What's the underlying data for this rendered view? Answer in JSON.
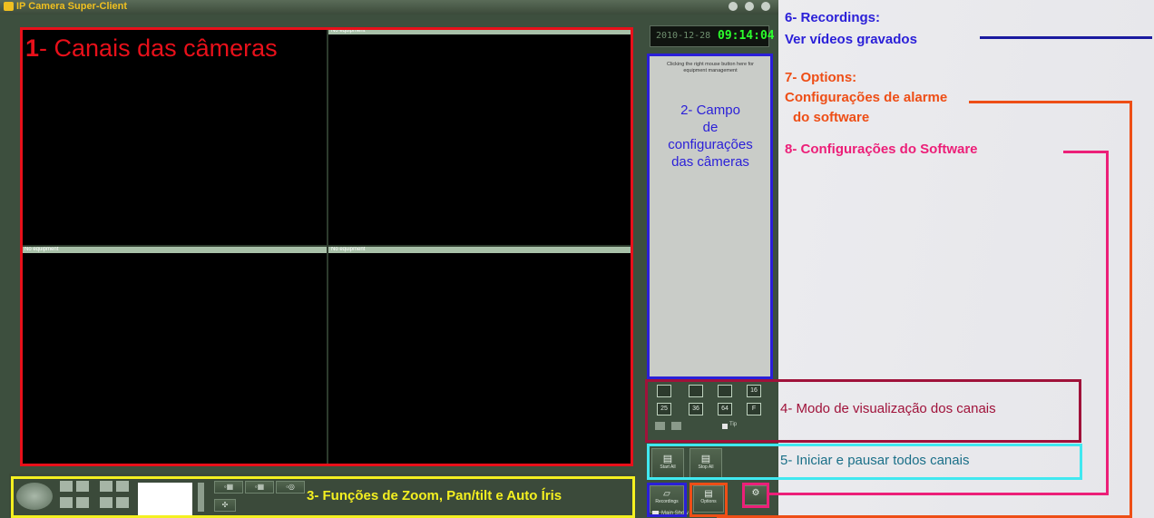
{
  "app": {
    "title": "IP Camera Super-Client",
    "clock": {
      "date": "2010-12-28",
      "time": "09:14:04"
    }
  },
  "video": {
    "labels": [
      "No equipment",
      "No equipment",
      "No equipment",
      "No equipment"
    ]
  },
  "panel": {
    "hint": "Clicking the right mouse button here for equipment management",
    "layout_buttons": [
      "",
      "",
      "",
      "16",
      "25",
      "36",
      "64",
      "F"
    ],
    "start_all": "Start All",
    "stop_all": "Stop All",
    "recordings": "Recordings",
    "options": "Options",
    "tip": "Tip",
    "main_show": "Main Show"
  },
  "annotations": {
    "a1_num": "1",
    "a1_text": "- Canais das câmeras",
    "a2": [
      "2- Campo",
      "de",
      "configurações",
      "das câmeras"
    ],
    "a3": "3- Funções de Zoom, Pan/tilt e Auto Íris",
    "a4": "4- Modo de visualização dos canais",
    "a5": "5- Iniciar e pausar todos canais",
    "a6_line1": "6- Recordings:",
    "a6_line2": "Ver vídeos gravados",
    "a7_line1": "7- Options:",
    "a7_line2": "Configurações de alarme",
    "a7_line3": "do software",
    "a8": "8- Configurações do Software"
  },
  "colors": {
    "red": "#e8101a",
    "blue": "#2a1fd8",
    "yellow": "#f4f020",
    "maroon": "#a0123a",
    "cyan": "#40e8f0",
    "orange": "#ee4e16",
    "pink": "#ec1f78",
    "teal": "#1a6f88",
    "navy": "#1a1aa0"
  }
}
